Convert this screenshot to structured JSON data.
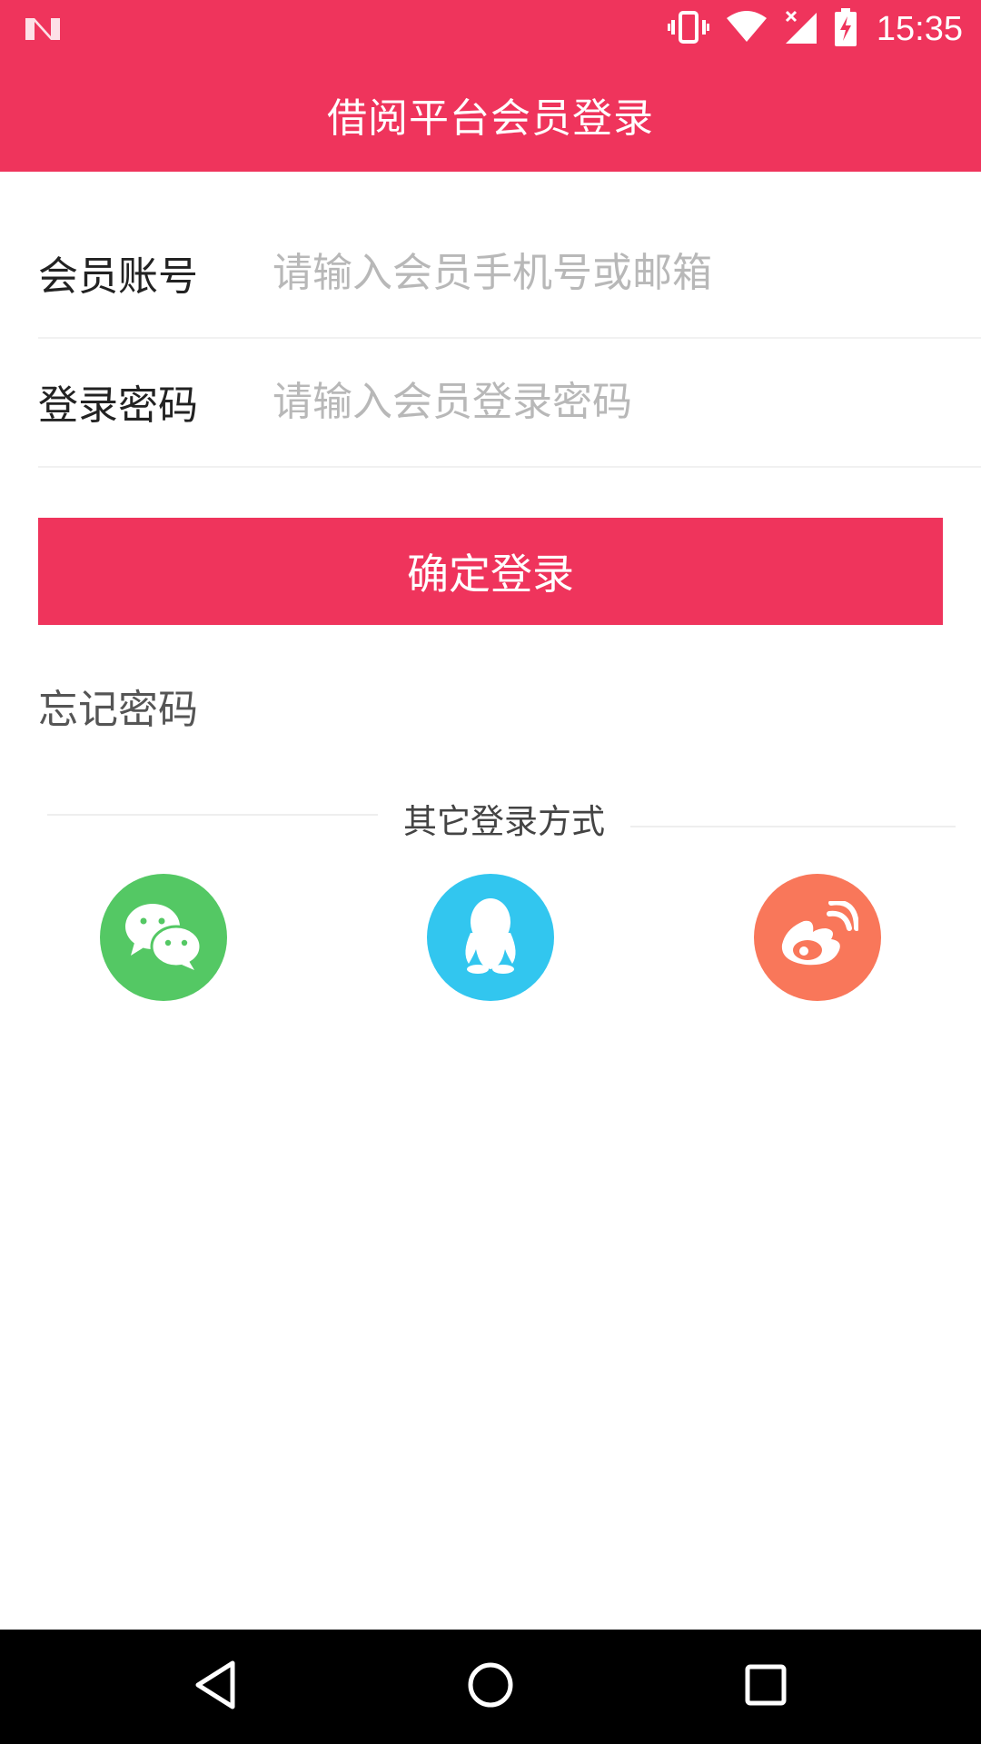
{
  "status_bar": {
    "time": "15:35",
    "icons": [
      "notification-n-icon",
      "vibrate-icon",
      "wifi-icon",
      "cell-signal-icon",
      "battery-charging-icon"
    ]
  },
  "header": {
    "title": "借阅平台会员登录"
  },
  "form": {
    "account": {
      "label": "会员账号",
      "placeholder": "请输入会员手机号或邮箱",
      "value": ""
    },
    "password": {
      "label": "登录密码",
      "placeholder": "请输入会员登录密码",
      "value": ""
    },
    "submit_label": "确定登录",
    "forgot_label": "忘记密码"
  },
  "other_login": {
    "label": "其它登录方式",
    "providers": [
      {
        "name": "wechat",
        "icon": "wechat-icon",
        "color": "#54c864"
      },
      {
        "name": "qq",
        "icon": "qq-penguin-icon",
        "color": "#32c6ef"
      },
      {
        "name": "weibo",
        "icon": "weibo-icon",
        "color": "#f9775a"
      }
    ]
  },
  "nav_bar": {
    "buttons": [
      "back-icon",
      "home-icon",
      "recents-icon"
    ]
  },
  "colors": {
    "accent": "#ef345c",
    "placeholder": "#b8b8b8",
    "divider": "#eeeeee",
    "nav_background": "#000000"
  }
}
